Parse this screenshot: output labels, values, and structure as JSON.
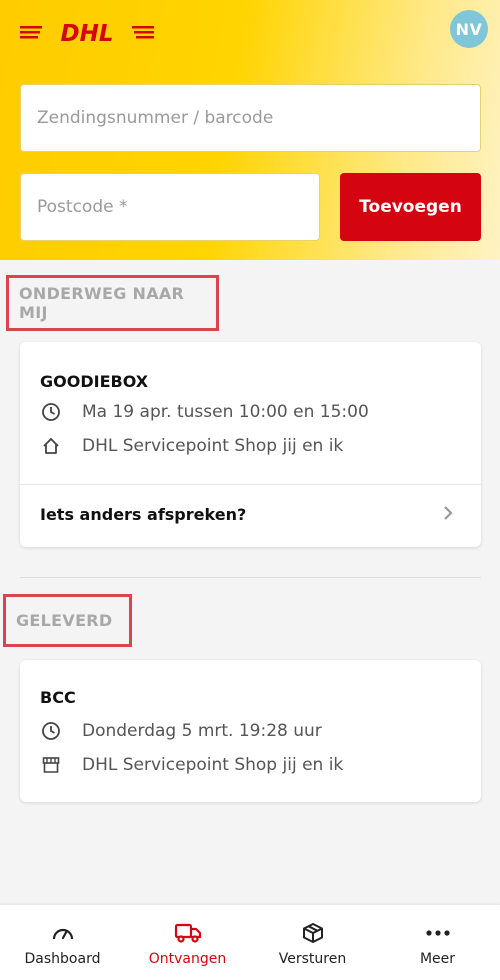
{
  "header": {
    "logo_text": "DHL",
    "avatar_initials": "NV",
    "tracking_placeholder": "Zendingsnummer / barcode",
    "postcode_placeholder": "Postcode *",
    "add_button": "Toevoegen"
  },
  "sections": {
    "onderweg": {
      "title": "ONDERWEG NAAR MIJ",
      "card": {
        "sender": "GOODIEBOX",
        "time": "Ma 19 apr. tussen 10:00 en 15:00",
        "location": "DHL Servicepoint Shop jij en ik",
        "action": "Iets anders afspreken?"
      }
    },
    "geleverd": {
      "title": "GELEVERD",
      "card": {
        "sender": "BCC",
        "time": "Donderdag 5 mrt. 19:28 uur",
        "location": "DHL Servicepoint Shop jij en ik"
      }
    }
  },
  "nav": {
    "items": [
      {
        "label": "Dashboard",
        "icon": "gauge-icon"
      },
      {
        "label": "Ontvangen",
        "icon": "truck-icon",
        "active": true
      },
      {
        "label": "Versturen",
        "icon": "package-icon"
      },
      {
        "label": "Meer",
        "icon": "more-dots-icon"
      }
    ]
  },
  "colors": {
    "brand_yellow": "#ffcc00",
    "brand_red": "#d40511",
    "avatar": "#7ec6d8",
    "highlight_border": "#d9454b"
  }
}
